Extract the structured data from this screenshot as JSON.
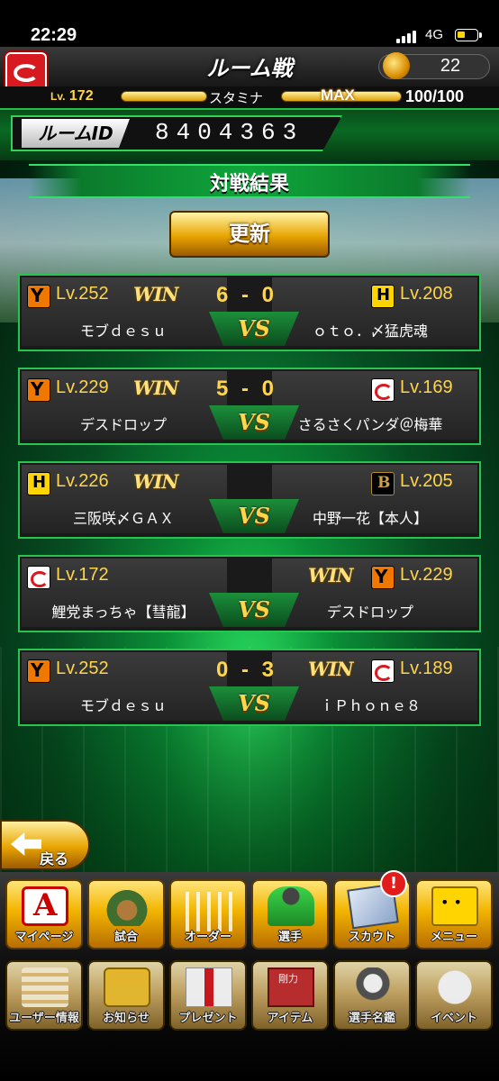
{
  "status_bar": {
    "time": "22:29",
    "network": "4G"
  },
  "header": {
    "title": "ルーム戦",
    "coins": "22"
  },
  "player": {
    "level_prefix": "Lv.",
    "level": "172",
    "stamina_label": "スタミナ",
    "stamina_state": "MAX",
    "stamina_value": "100/100"
  },
  "room": {
    "label": "ルームID",
    "id": "8404363"
  },
  "results": {
    "title": "対戦結果",
    "refresh_label": "更新",
    "vs_label": "VS",
    "win_label": "WIN",
    "matches": [
      {
        "left": {
          "team": "giants",
          "level": "Lv.252",
          "name": "モブｄｅｓｕ"
        },
        "right": {
          "team": "tigers",
          "level": "Lv.208",
          "name": "ｏｔｏ．〆猛虎魂"
        },
        "winner": "left",
        "score": "6 - 0"
      },
      {
        "left": {
          "team": "giants",
          "level": "Lv.229",
          "name": "デスドロップ"
        },
        "right": {
          "team": "carp",
          "level": "Lv.169",
          "name": "さるさくパンダ＠梅華"
        },
        "winner": "left",
        "score": "5 - 0"
      },
      {
        "left": {
          "team": "tigers",
          "level": "Lv.226",
          "name": "三阪咲〆ＧＡＸ"
        },
        "right": {
          "team": "buffaloes",
          "level": "Lv.205",
          "name": "中野一花【本人】"
        },
        "winner": "left",
        "score": ""
      },
      {
        "left": {
          "team": "carp",
          "level": "Lv.172",
          "name": "鯉党まっちゃ【彗龍】"
        },
        "right": {
          "team": "giants",
          "level": "Lv.229",
          "name": "デスドロップ"
        },
        "winner": "right",
        "score": ""
      },
      {
        "left": {
          "team": "giants",
          "level": "Lv.252",
          "name": "モブｄｅｓｕ"
        },
        "right": {
          "team": "carp",
          "level": "Lv.189",
          "name": "ｉＰｈｏｎｅ８"
        },
        "winner": "right",
        "score": "0 - 3"
      }
    ]
  },
  "back_label": "戻る",
  "nav": {
    "row1": [
      {
        "label": "マイページ",
        "icon": "mypage-icon"
      },
      {
        "label": "試合",
        "icon": "stadium-icon"
      },
      {
        "label": "オーダー",
        "icon": "order-icon"
      },
      {
        "label": "選手",
        "icon": "player-icon"
      },
      {
        "label": "スカウト",
        "icon": "scout-icon"
      },
      {
        "label": "メニュー",
        "icon": "menu-icon"
      }
    ],
    "row2": [
      {
        "label": "ユーザー情報",
        "icon": "user-info-icon"
      },
      {
        "label": "お知らせ",
        "icon": "notice-icon"
      },
      {
        "label": "プレゼント",
        "icon": "present-icon"
      },
      {
        "label": "アイテム",
        "icon": "item-icon"
      },
      {
        "label": "選手名鑑",
        "icon": "catalog-icon"
      },
      {
        "label": "イベント",
        "icon": "event-icon"
      }
    ],
    "scout_badge": "!"
  }
}
